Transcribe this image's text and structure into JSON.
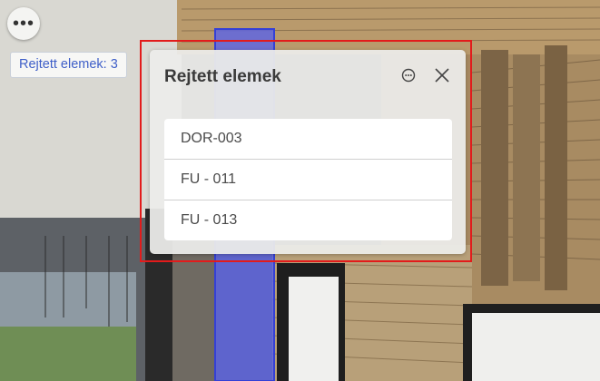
{
  "toolbar": {
    "menu_label": "•••",
    "menu_icon": "more-horizontal-icon"
  },
  "hidden_elements": {
    "badge_label": "Rejtett elemek: 3"
  },
  "panel": {
    "title": "Rejtett elemek",
    "more_icon": "more-options-icon",
    "close_icon": "close-icon",
    "items": [
      {
        "label": "DOR-003"
      },
      {
        "label": "FU - 011"
      },
      {
        "label": "FU - 013"
      }
    ]
  },
  "colors": {
    "highlight_border": "#e21b1b",
    "link_text": "#3f5fc8",
    "selected_element": "#5a63e8"
  }
}
